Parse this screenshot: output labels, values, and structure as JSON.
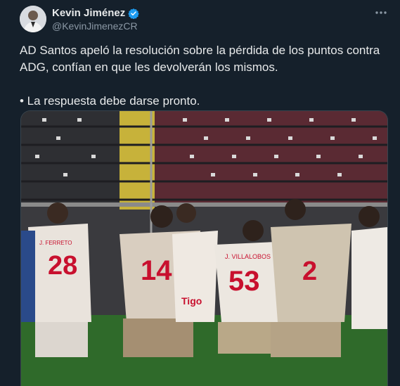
{
  "author": {
    "display_name": "Kevin Jiménez",
    "handle": "@KevinJimenezCR",
    "verified_icon": "verified-badge-icon",
    "avatar_icon": "avatar-photo"
  },
  "menu": {
    "icon": "more-horizontal-icon"
  },
  "tweet": {
    "line1": "AD Santos apeló la resolución sobre la pérdida de los puntos contra ADG, confían en que les devolverán los mismos.",
    "line2": "• La respuesta debe darse pronto."
  },
  "media": {
    "description_icon": "team-photo",
    "jersey_numbers": [
      "28",
      "14",
      "53",
      "2"
    ],
    "jersey_names": [
      "J. FERRETO",
      "J. VILLALOBOS"
    ],
    "sponsor": "Tigo"
  },
  "colors": {
    "background": "#15202b",
    "text": "#e7e9ea",
    "muted": "#8b98a5",
    "verified": "#1d9bf0",
    "jersey_number": "#c8102e"
  }
}
